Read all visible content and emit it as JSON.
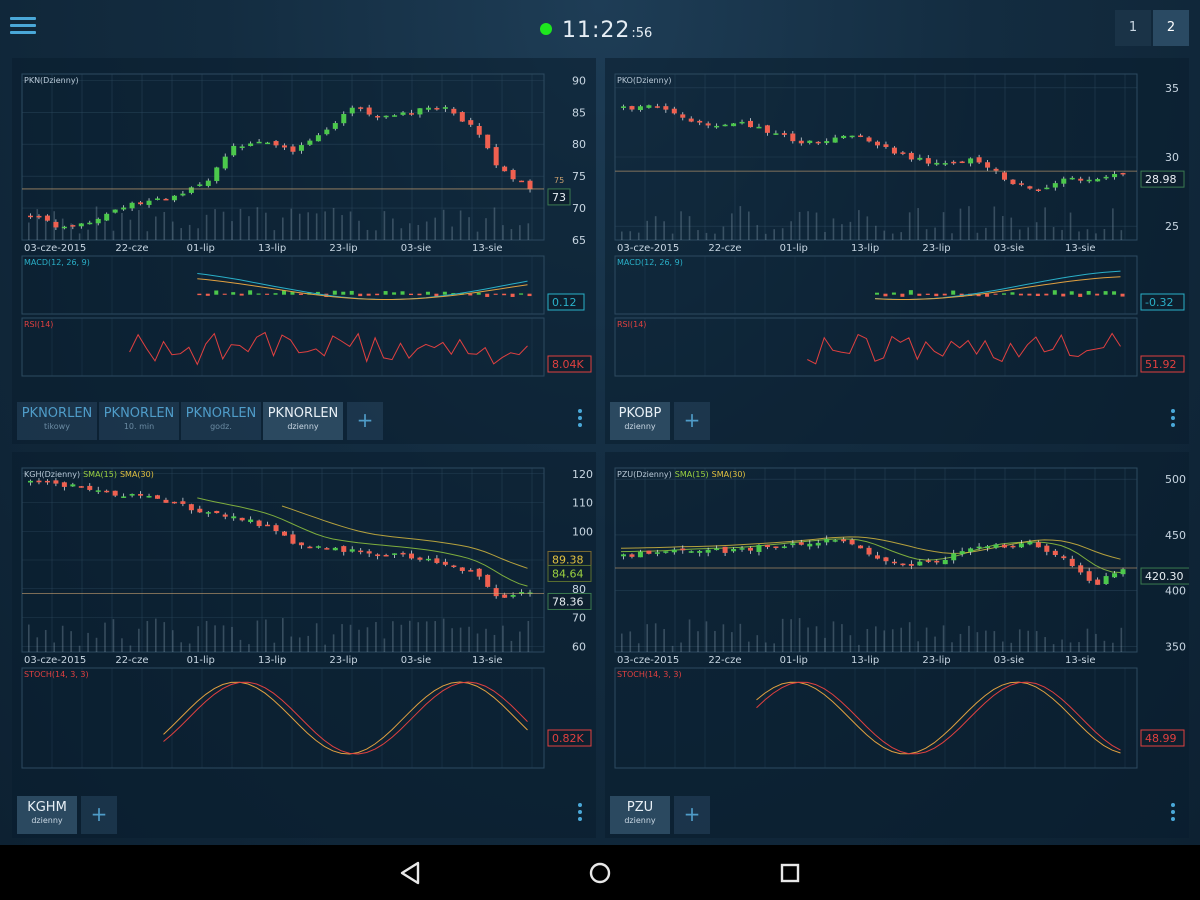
{
  "clock": {
    "time_hm": "11:22",
    "time_sec": ":56",
    "status_color": "#1ee61e"
  },
  "pages": [
    "1",
    "2"
  ],
  "colors": {
    "up": "#4cc84c",
    "down": "#f06050",
    "price_line": "#c8a070",
    "label_box_border": "#3a7a50",
    "grid": "#2d4a60",
    "axis_text": "#c8d6e2"
  },
  "panels": [
    {
      "id": "pkn",
      "header": "PKN(Dzienny)",
      "header_extra": [],
      "price_ticks": [
        "90",
        "85",
        "80",
        "75",
        "70",
        "65"
      ],
      "price_range": [
        65,
        91
      ],
      "dates": [
        "03-cze-2015",
        "22-cze",
        "01-lip",
        "13-lip",
        "23-lip",
        "03-sie",
        "13-sie"
      ],
      "last_price_label": "73",
      "last_price_tag": "75",
      "indicators": [
        {
          "name": "MACD(12, 26, 9)",
          "value": "0.12",
          "name_color": "#2ab0c8",
          "value_color": "#2ab0c8",
          "kind": "macd"
        },
        {
          "name": "RSI(14)",
          "value": "8.04K",
          "name_color": "#e04040",
          "value_color": "#e04040",
          "kind": "rsi"
        }
      ],
      "tabs": [
        {
          "t1": "PKNORLEN",
          "t2": "tikowy",
          "active": false
        },
        {
          "t1": "PKNORLEN",
          "t2": "10. min",
          "active": false
        },
        {
          "t1": "PKNORLEN",
          "t2": "godz.",
          "active": false
        },
        {
          "t1": "PKNORLEN",
          "t2": "dzienny",
          "active": true
        }
      ],
      "add_label": "+"
    },
    {
      "id": "pko",
      "header": "PKO(Dzienny)",
      "header_extra": [],
      "price_ticks": [
        "35",
        "30",
        "25"
      ],
      "price_range": [
        24,
        36
      ],
      "dates": [
        "03-cze-2015",
        "22-cze",
        "01-lip",
        "13-lip",
        "23-lip",
        "03-sie",
        "13-sie"
      ],
      "last_price_label": "28.98",
      "last_price_tag": "",
      "indicators": [
        {
          "name": "MACD(12, 26, 9)",
          "value": "-0.32",
          "name_color": "#2ab0c8",
          "value_color": "#2ab0c8",
          "kind": "macd"
        },
        {
          "name": "RSI(14)",
          "value": "51.92",
          "name_color": "#e04040",
          "value_color": "#e04040",
          "kind": "rsi"
        }
      ],
      "tabs": [
        {
          "t1": "PKOBP",
          "t2": "dzienny",
          "active": true
        }
      ],
      "add_label": "+"
    },
    {
      "id": "kgh",
      "header": "KGH(Dzienny)",
      "header_extra": [
        {
          "text": "SMA(15)",
          "color": "#9ad040"
        },
        {
          "text": "SMA(30)",
          "color": "#e0c040"
        }
      ],
      "price_ticks": [
        "120",
        "110",
        "100",
        "90",
        "80",
        "70",
        "60"
      ],
      "price_range": [
        58,
        122
      ],
      "dates": [
        "03-cze-2015",
        "22-cze",
        "01-lip",
        "13-lip",
        "23-lip",
        "03-sie",
        "13-sie"
      ],
      "last_price_label": "78.36",
      "last_price_tag": "",
      "sma_labels": [
        "89.38",
        "84.64"
      ],
      "indicators": [
        {
          "name": "STOCH(14, 3, 3)",
          "value": "0.82K",
          "name_color": "#e04040",
          "value_color": "#e04040",
          "kind": "stoch"
        }
      ],
      "tabs": [
        {
          "t1": "KGHM",
          "t2": "dzienny",
          "active": true
        }
      ],
      "add_label": "+"
    },
    {
      "id": "pzu",
      "header": "PZU(Dzienny)",
      "header_extra": [
        {
          "text": "SMA(15)",
          "color": "#9ad040"
        },
        {
          "text": "SMA(30)",
          "color": "#e0c040"
        }
      ],
      "price_ticks": [
        "500",
        "450",
        "400",
        "350"
      ],
      "price_range": [
        345,
        510
      ],
      "dates": [
        "03-cze-2015",
        "22-cze",
        "01-lip",
        "13-lip",
        "23-lip",
        "03-sie",
        "13-sie"
      ],
      "last_price_label": "420.30",
      "last_price_tag": "",
      "indicators": [
        {
          "name": "STOCH(14, 3, 3)",
          "value": "48.99",
          "name_color": "#e04040",
          "value_color": "#e04040",
          "kind": "stoch"
        }
      ],
      "tabs": [
        {
          "t1": "PZU",
          "t2": "dzienny",
          "active": true
        }
      ],
      "add_label": "+"
    }
  ],
  "chart_data": [
    {
      "type": "candlestick",
      "title": "PKN(Dzienny)",
      "x": [
        "03-cze-2015",
        "22-cze",
        "01-lip",
        "13-lip",
        "23-lip",
        "03-sie",
        "13-sie"
      ],
      "close": [
        69,
        67,
        68,
        70,
        71,
        72,
        74,
        80,
        80,
        79,
        82,
        86,
        84,
        85,
        86,
        83,
        76,
        73
      ],
      "ylim": [
        65,
        90
      ]
    },
    {
      "type": "candlestick",
      "title": "PKO(Dzienny)",
      "x": [
        "03-cze-2015",
        "22-cze",
        "01-lip",
        "13-lip",
        "23-lip",
        "03-sie",
        "13-sie"
      ],
      "close": [
        33.5,
        33.6,
        32.8,
        32.3,
        32.5,
        31.8,
        31.0,
        31.3,
        31.6,
        30.6,
        29.8,
        29.5,
        29.9,
        28.4,
        27.5,
        28.6,
        28.3,
        28.98
      ],
      "ylim": [
        25,
        35
      ]
    },
    {
      "type": "candlestick",
      "title": "KGH(Dzienny)",
      "x": [
        "03-cze-2015",
        "22-cze",
        "01-lip",
        "13-lip",
        "23-lip",
        "03-sie",
        "13-sie"
      ],
      "close": [
        117,
        116,
        115,
        113,
        112,
        109,
        107,
        105,
        102,
        96,
        94,
        93,
        92,
        91,
        89,
        86,
        77,
        78.36
      ],
      "ylim": [
        60,
        120
      ]
    },
    {
      "type": "candlestick",
      "title": "PZU(Dzienny)",
      "x": [
        "03-cze-2015",
        "22-cze",
        "01-lip",
        "13-lip",
        "23-lip",
        "03-sie",
        "13-sie"
      ],
      "close": [
        432,
        433,
        435,
        435,
        437,
        440,
        442,
        445,
        440,
        425,
        423,
        430,
        440,
        440,
        442,
        430,
        405,
        420.3
      ],
      "ylim": [
        350,
        500
      ]
    }
  ]
}
